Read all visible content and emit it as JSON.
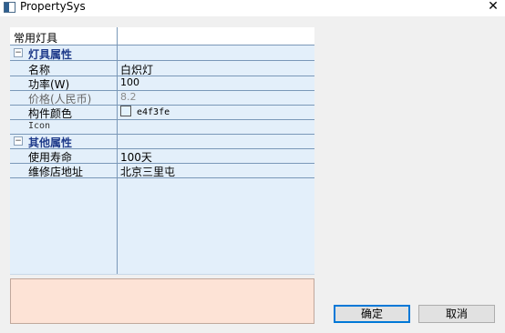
{
  "window": {
    "title": "PropertySys",
    "close_glyph": "✕"
  },
  "grid": {
    "header": "常用灯具",
    "categories": [
      {
        "label": "灯具属性",
        "toggle": "−",
        "properties": [
          {
            "name": "名称",
            "value": "白炽灯"
          },
          {
            "name": "功率(W)",
            "value": "100"
          },
          {
            "name": "价格(人民币)",
            "value": "8.2"
          },
          {
            "name": "构件颜色",
            "value": "e4f3fe",
            "swatch_color": "#e4f3fe"
          },
          {
            "name": "Icon",
            "value": ""
          }
        ]
      },
      {
        "label": "其他属性",
        "toggle": "−",
        "properties": [
          {
            "name": "使用寿命",
            "value": "100天"
          },
          {
            "name": "维修店地址",
            "value": "北京三里屯"
          }
        ]
      }
    ]
  },
  "buttons": {
    "ok": "确定",
    "cancel": "取消"
  },
  "colors": {
    "grid_background": "#e3effa",
    "category_text": "#1e3a8a",
    "description_background": "#fde3d6"
  }
}
